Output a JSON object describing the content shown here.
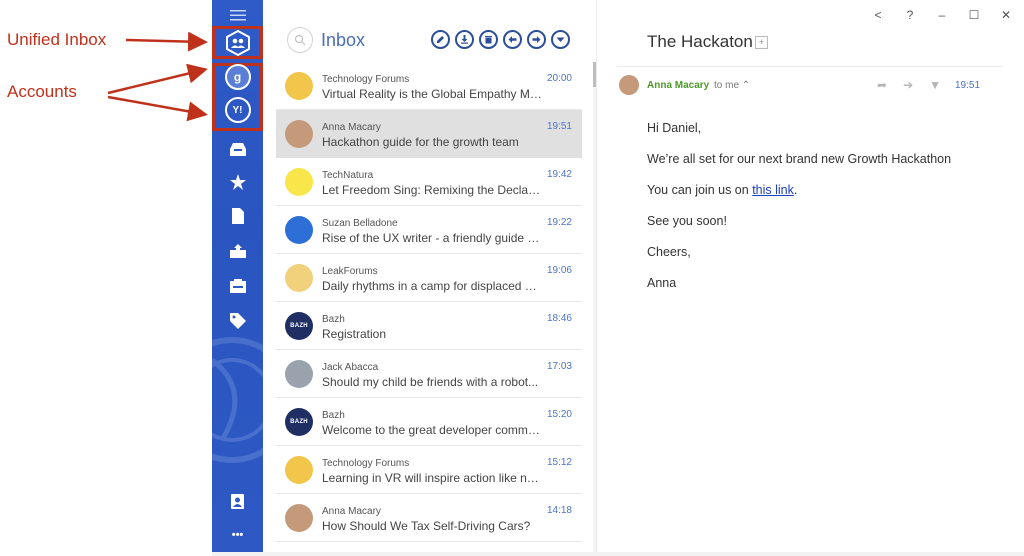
{
  "annotations": {
    "unified_inbox": "Unified Inbox",
    "accounts": "Accounts",
    "color": "#c0311b"
  },
  "sidebar": {
    "accent": "#2f5bc8",
    "items": [
      {
        "icon": "menu-icon"
      },
      {
        "icon": "unified-inbox-icon"
      },
      {
        "icon": "google-account-icon",
        "label": "g"
      },
      {
        "icon": "yahoo-account-icon",
        "label": "Y!"
      },
      {
        "icon": "inbox-tray-icon"
      },
      {
        "icon": "star-icon"
      },
      {
        "icon": "document-icon"
      },
      {
        "icon": "sent-tray-icon"
      },
      {
        "icon": "archive-icon"
      },
      {
        "icon": "tags-icon"
      },
      {
        "icon": "contacts-icon"
      },
      {
        "icon": "more-icon",
        "label": "•••"
      }
    ]
  },
  "list": {
    "title": "Inbox",
    "toolbar_icons": [
      "compose-icon",
      "download-icon",
      "delete-icon",
      "reply-icon",
      "forward-icon",
      "more-down-icon"
    ],
    "messages": [
      {
        "sender": "Technology Forums",
        "subject": "Virtual Reality is the Global Empathy Ma...",
        "time": "20:00",
        "avatar": "tf"
      },
      {
        "sender": "Anna Macary",
        "subject": "Hackathon guide for the growth team",
        "time": "19:51",
        "avatar": "person",
        "selected": true
      },
      {
        "sender": "TechNatura",
        "subject": "Let Freedom Sing: Remixing the Declaratio...",
        "time": "19:42",
        "avatar": "tn"
      },
      {
        "sender": "Suzan Belladone",
        "subject": "Rise of the UX writer - a friendly guide of...",
        "time": "19:22",
        "avatar": "person2"
      },
      {
        "sender": "LeakForums",
        "subject": "Daily rhythms in a camp for displaced pe...",
        "time": "19:06",
        "avatar": "lego"
      },
      {
        "sender": "Bazh",
        "subject": "Registration",
        "time": "18:46",
        "avatar": "bazh",
        "avatar_text": "BAZH"
      },
      {
        "sender": "Jack Abacca",
        "subject": "Should my child be friends with a robot...",
        "time": "17:03",
        "avatar": "person3"
      },
      {
        "sender": "Bazh",
        "subject": "Welcome to the great developer commu...",
        "time": "15:20",
        "avatar": "bazh",
        "avatar_text": "BAZH"
      },
      {
        "sender": "Technology Forums",
        "subject": "Learning in VR will inspire action like nev...",
        "time": "15:12",
        "avatar": "tf"
      },
      {
        "sender": "Anna Macary",
        "subject": "How Should We Tax Self-Driving Cars?",
        "time": "14:18",
        "avatar": "person"
      }
    ]
  },
  "reader": {
    "window_controls": [
      "<",
      "?",
      "–",
      "☐",
      "✕"
    ],
    "title": "The Hackaton",
    "from": "Anna Macary",
    "to": "to me",
    "time": "19:51",
    "body": {
      "greeting": "Hi Daniel,",
      "line1": "We’re all set for our next brand new Growth Hackathon",
      "line2_prefix": "You can join us on ",
      "line2_link": "this link",
      "line2_suffix": ".",
      "line3": "See you soon!",
      "line4": "Cheers,",
      "signature": "Anna"
    }
  }
}
